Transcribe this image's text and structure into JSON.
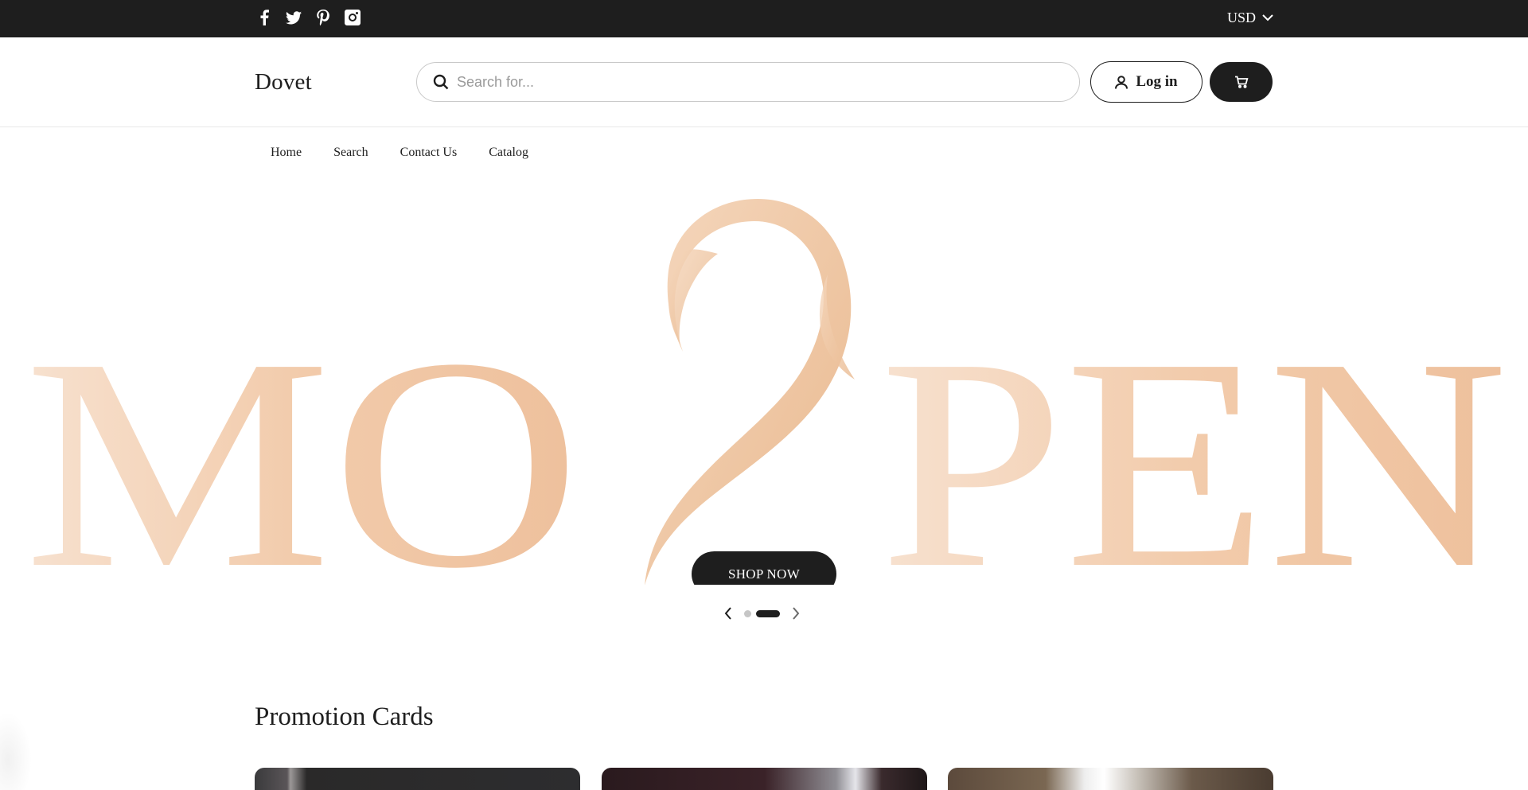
{
  "topbar": {
    "social": [
      {
        "icon": "facebook-icon"
      },
      {
        "icon": "twitter-icon"
      },
      {
        "icon": "pinterest-icon"
      },
      {
        "icon": "instagram-icon"
      }
    ],
    "currency": "USD"
  },
  "header": {
    "logo": "Dovet",
    "search_placeholder": "Search for...",
    "login_label": "Log in"
  },
  "nav": {
    "items": [
      "Home",
      "Search",
      "Contact Us",
      "Catalog"
    ]
  },
  "hero": {
    "background_word": "MO PEN",
    "cta_label": "SHOP NOW",
    "slides_total": 2,
    "active_slide": 2,
    "colors": {
      "peach": "#f0c7a4",
      "peach_light": "#f6dcc6"
    }
  },
  "promotions": {
    "title": "Promotion Cards"
  },
  "colors": {
    "dark": "#1e1e1e",
    "white": "#ffffff"
  }
}
